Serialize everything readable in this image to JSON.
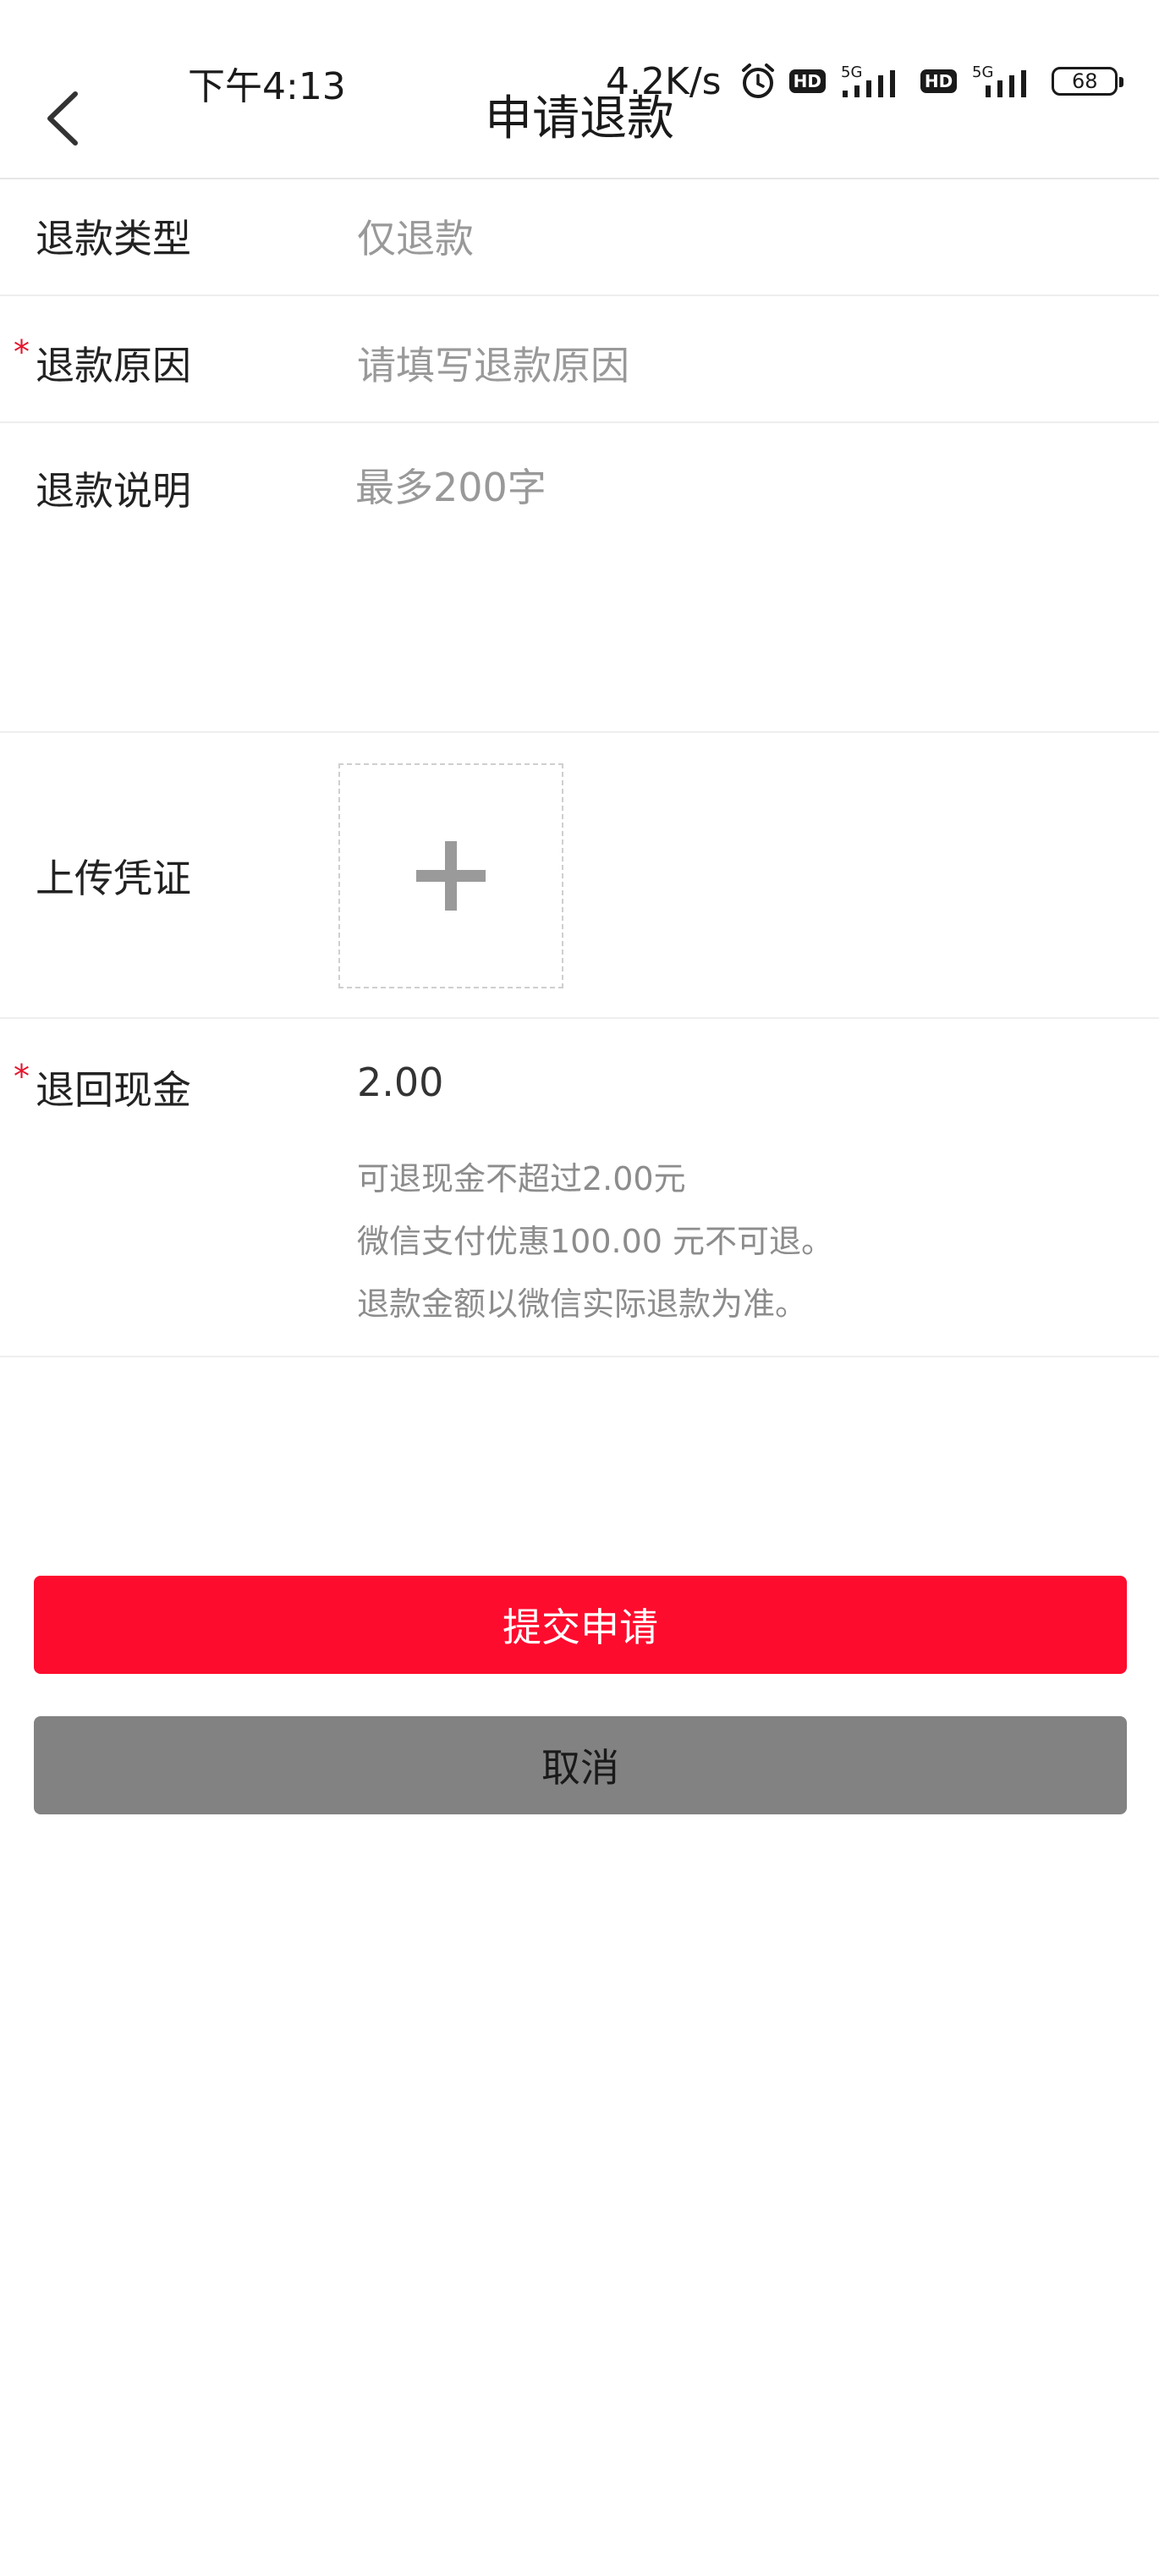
{
  "status_bar": {
    "time": "下午4:13",
    "net_speed": "4.2K/s",
    "hd_label": "HD",
    "network_label": "5G",
    "battery_level": "68",
    "icons": [
      "alarm-icon",
      "hd-badge",
      "signal-5g-icon",
      "battery-icon"
    ]
  },
  "nav": {
    "title": "申请退款",
    "back_icon": "chevron-left-icon"
  },
  "form": {
    "refund_type": {
      "label": "退款类型",
      "value": "仅退款"
    },
    "refund_reason": {
      "label": "退款原因",
      "required": "*",
      "placeholder": "请填写退款原因"
    },
    "refund_note": {
      "label": "退款说明",
      "placeholder": "最多200字"
    },
    "upload": {
      "label": "上传凭证",
      "icon": "plus-icon"
    },
    "refund_cash": {
      "label": "退回现金",
      "required": "*",
      "value": "2.00",
      "hints": [
        "可退现金不超过2.00元",
        "微信支付优惠100.00 元不可退。",
        "退款金额以微信实际退款为准。"
      ]
    }
  },
  "actions": {
    "submit_label": "提交申请",
    "cancel_label": "取消"
  },
  "colors": {
    "primary": "#fe0c2e",
    "secondary": "#828282",
    "required": "#e4152c",
    "placeholder": "#999999"
  }
}
